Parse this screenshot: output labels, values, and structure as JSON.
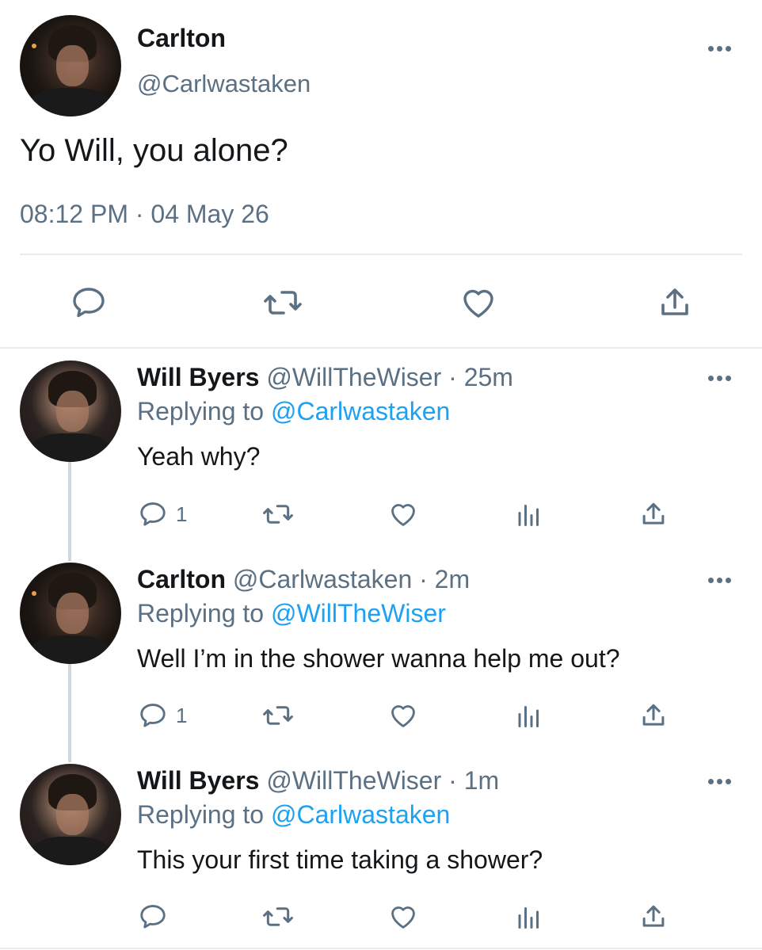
{
  "main_tweet": {
    "name": "Carlton",
    "handle": "@Carlwastaken",
    "text": "Yo Will, you alone?",
    "timestamp": "08:12 PM · 04 May 26",
    "avatar_icon": "avatar-photo-carlton"
  },
  "replies": [
    {
      "name": "Will Byers",
      "handle": "@WillTheWiser",
      "time": "· 25m",
      "replying_label": "Replying to",
      "replying_to": "@Carlwastaken",
      "text": "Yeah why?",
      "reply_count": "1",
      "avatar_icon": "avatar-photo-will"
    },
    {
      "name": "Carlton",
      "handle": "@Carlwastaken",
      "time": "· 2m",
      "replying_label": "Replying to",
      "replying_to": "@WillTheWiser",
      "text": "Well I’m in the shower wanna help me out?",
      "reply_count": "1",
      "avatar_icon": "avatar-photo-carlton"
    },
    {
      "name": "Will Byers",
      "handle": "@WillTheWiser",
      "time": "· 1m",
      "replying_label": "Replying to",
      "replying_to": "@Carlwastaken",
      "text": "This your first time taking a shower?",
      "reply_count": "",
      "avatar_icon": "avatar-photo-will"
    }
  ],
  "colors": {
    "accent": "#1da1f2",
    "secondary_text": "#5b7083",
    "primary_text": "#14171a",
    "divider": "#e6ecf0"
  },
  "icons": [
    "reply-icon",
    "retweet-icon",
    "like-icon",
    "share-icon",
    "analytics-icon",
    "more-icon"
  ]
}
